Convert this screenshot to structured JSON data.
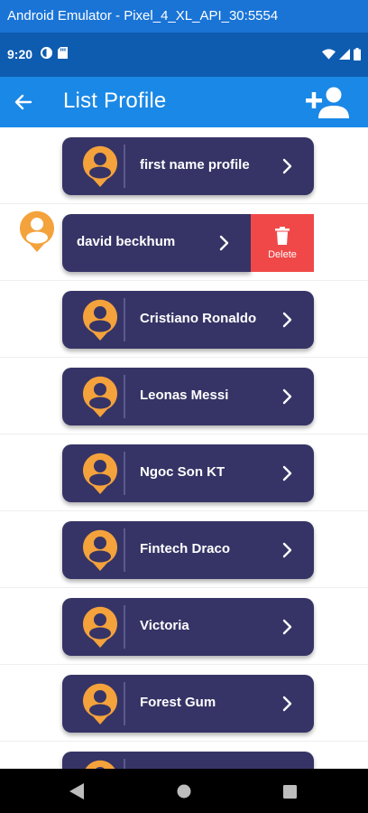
{
  "window": {
    "title": "Android Emulator - Pixel_4_XL_API_30:5554"
  },
  "status_bar": {
    "time": "9:20",
    "left_icons": [
      "data-saver-icon",
      "sd-card-icon"
    ],
    "right_icons": [
      "wifi-icon",
      "signal-icon",
      "battery-icon"
    ]
  },
  "app_bar": {
    "title": "List Profile",
    "back_icon": "arrow-back-icon",
    "action_icon": "person-add-icon"
  },
  "profiles": [
    {
      "name": "first name profile"
    },
    {
      "name": "david beckhum",
      "swiped_open": true,
      "action_label": "Delete"
    },
    {
      "name": "Cristiano Ronaldo"
    },
    {
      "name": "Leonas Messi"
    },
    {
      "name": "Ngoc Son KT"
    },
    {
      "name": "Fintech Draco"
    },
    {
      "name": "Victoria"
    },
    {
      "name": "Forest Gum"
    },
    {
      "name": ""
    }
  ],
  "nav_bar": {
    "buttons": [
      "back-triangle-icon",
      "home-circle-icon",
      "recents-square-icon"
    ]
  },
  "colors": {
    "emulator_bar": "#1a74d6",
    "status_bar": "#0d5cb0",
    "app_bar": "#1a88e6",
    "card": "#363466",
    "avatar": "#f4a23c",
    "delete": "#f04848"
  }
}
